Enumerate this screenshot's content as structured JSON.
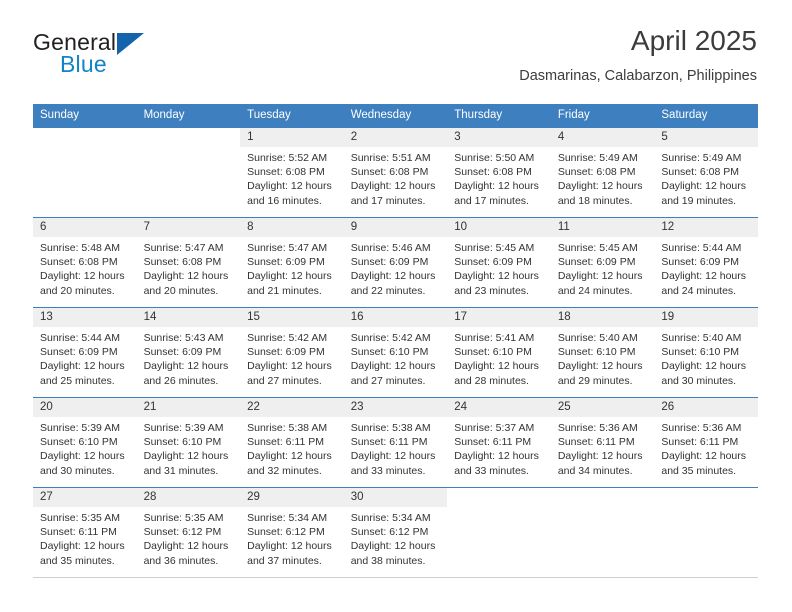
{
  "logo": {
    "word1": "General",
    "word2": "Blue",
    "triangle_color": "#1464ab",
    "blue_color": "#1383c6"
  },
  "header": {
    "title": "April 2025",
    "subtitle": "Dasmarinas, Calabarzon, Philippines"
  },
  "theme": {
    "header_blue": "#3d7fbf",
    "daynum_gray": "#efefef",
    "text": "#333333"
  },
  "calendar": {
    "weekday_headers": [
      "Sunday",
      "Monday",
      "Tuesday",
      "Wednesday",
      "Thursday",
      "Friday",
      "Saturday"
    ],
    "labels": {
      "sunrise": "Sunrise:",
      "sunset": "Sunset:",
      "daylight": "Daylight:"
    },
    "weeks": [
      [
        {
          "day": "",
          "sunrise": "",
          "sunset": "",
          "daylight_l1": "",
          "daylight_l2": ""
        },
        {
          "day": "",
          "sunrise": "",
          "sunset": "",
          "daylight_l1": "",
          "daylight_l2": ""
        },
        {
          "day": "1",
          "sunrise": "Sunrise: 5:52 AM",
          "sunset": "Sunset: 6:08 PM",
          "daylight_l1": "Daylight: 12 hours",
          "daylight_l2": "and 16 minutes."
        },
        {
          "day": "2",
          "sunrise": "Sunrise: 5:51 AM",
          "sunset": "Sunset: 6:08 PM",
          "daylight_l1": "Daylight: 12 hours",
          "daylight_l2": "and 17 minutes."
        },
        {
          "day": "3",
          "sunrise": "Sunrise: 5:50 AM",
          "sunset": "Sunset: 6:08 PM",
          "daylight_l1": "Daylight: 12 hours",
          "daylight_l2": "and 17 minutes."
        },
        {
          "day": "4",
          "sunrise": "Sunrise: 5:49 AM",
          "sunset": "Sunset: 6:08 PM",
          "daylight_l1": "Daylight: 12 hours",
          "daylight_l2": "and 18 minutes."
        },
        {
          "day": "5",
          "sunrise": "Sunrise: 5:49 AM",
          "sunset": "Sunset: 6:08 PM",
          "daylight_l1": "Daylight: 12 hours",
          "daylight_l2": "and 19 minutes."
        }
      ],
      [
        {
          "day": "6",
          "sunrise": "Sunrise: 5:48 AM",
          "sunset": "Sunset: 6:08 PM",
          "daylight_l1": "Daylight: 12 hours",
          "daylight_l2": "and 20 minutes."
        },
        {
          "day": "7",
          "sunrise": "Sunrise: 5:47 AM",
          "sunset": "Sunset: 6:08 PM",
          "daylight_l1": "Daylight: 12 hours",
          "daylight_l2": "and 20 minutes."
        },
        {
          "day": "8",
          "sunrise": "Sunrise: 5:47 AM",
          "sunset": "Sunset: 6:09 PM",
          "daylight_l1": "Daylight: 12 hours",
          "daylight_l2": "and 21 minutes."
        },
        {
          "day": "9",
          "sunrise": "Sunrise: 5:46 AM",
          "sunset": "Sunset: 6:09 PM",
          "daylight_l1": "Daylight: 12 hours",
          "daylight_l2": "and 22 minutes."
        },
        {
          "day": "10",
          "sunrise": "Sunrise: 5:45 AM",
          "sunset": "Sunset: 6:09 PM",
          "daylight_l1": "Daylight: 12 hours",
          "daylight_l2": "and 23 minutes."
        },
        {
          "day": "11",
          "sunrise": "Sunrise: 5:45 AM",
          "sunset": "Sunset: 6:09 PM",
          "daylight_l1": "Daylight: 12 hours",
          "daylight_l2": "and 24 minutes."
        },
        {
          "day": "12",
          "sunrise": "Sunrise: 5:44 AM",
          "sunset": "Sunset: 6:09 PM",
          "daylight_l1": "Daylight: 12 hours",
          "daylight_l2": "and 24 minutes."
        }
      ],
      [
        {
          "day": "13",
          "sunrise": "Sunrise: 5:44 AM",
          "sunset": "Sunset: 6:09 PM",
          "daylight_l1": "Daylight: 12 hours",
          "daylight_l2": "and 25 minutes."
        },
        {
          "day": "14",
          "sunrise": "Sunrise: 5:43 AM",
          "sunset": "Sunset: 6:09 PM",
          "daylight_l1": "Daylight: 12 hours",
          "daylight_l2": "and 26 minutes."
        },
        {
          "day": "15",
          "sunrise": "Sunrise: 5:42 AM",
          "sunset": "Sunset: 6:09 PM",
          "daylight_l1": "Daylight: 12 hours",
          "daylight_l2": "and 27 minutes."
        },
        {
          "day": "16",
          "sunrise": "Sunrise: 5:42 AM",
          "sunset": "Sunset: 6:10 PM",
          "daylight_l1": "Daylight: 12 hours",
          "daylight_l2": "and 27 minutes."
        },
        {
          "day": "17",
          "sunrise": "Sunrise: 5:41 AM",
          "sunset": "Sunset: 6:10 PM",
          "daylight_l1": "Daylight: 12 hours",
          "daylight_l2": "and 28 minutes."
        },
        {
          "day": "18",
          "sunrise": "Sunrise: 5:40 AM",
          "sunset": "Sunset: 6:10 PM",
          "daylight_l1": "Daylight: 12 hours",
          "daylight_l2": "and 29 minutes."
        },
        {
          "day": "19",
          "sunrise": "Sunrise: 5:40 AM",
          "sunset": "Sunset: 6:10 PM",
          "daylight_l1": "Daylight: 12 hours",
          "daylight_l2": "and 30 minutes."
        }
      ],
      [
        {
          "day": "20",
          "sunrise": "Sunrise: 5:39 AM",
          "sunset": "Sunset: 6:10 PM",
          "daylight_l1": "Daylight: 12 hours",
          "daylight_l2": "and 30 minutes."
        },
        {
          "day": "21",
          "sunrise": "Sunrise: 5:39 AM",
          "sunset": "Sunset: 6:10 PM",
          "daylight_l1": "Daylight: 12 hours",
          "daylight_l2": "and 31 minutes."
        },
        {
          "day": "22",
          "sunrise": "Sunrise: 5:38 AM",
          "sunset": "Sunset: 6:11 PM",
          "daylight_l1": "Daylight: 12 hours",
          "daylight_l2": "and 32 minutes."
        },
        {
          "day": "23",
          "sunrise": "Sunrise: 5:38 AM",
          "sunset": "Sunset: 6:11 PM",
          "daylight_l1": "Daylight: 12 hours",
          "daylight_l2": "and 33 minutes."
        },
        {
          "day": "24",
          "sunrise": "Sunrise: 5:37 AM",
          "sunset": "Sunset: 6:11 PM",
          "daylight_l1": "Daylight: 12 hours",
          "daylight_l2": "and 33 minutes."
        },
        {
          "day": "25",
          "sunrise": "Sunrise: 5:36 AM",
          "sunset": "Sunset: 6:11 PM",
          "daylight_l1": "Daylight: 12 hours",
          "daylight_l2": "and 34 minutes."
        },
        {
          "day": "26",
          "sunrise": "Sunrise: 5:36 AM",
          "sunset": "Sunset: 6:11 PM",
          "daylight_l1": "Daylight: 12 hours",
          "daylight_l2": "and 35 minutes."
        }
      ],
      [
        {
          "day": "27",
          "sunrise": "Sunrise: 5:35 AM",
          "sunset": "Sunset: 6:11 PM",
          "daylight_l1": "Daylight: 12 hours",
          "daylight_l2": "and 35 minutes."
        },
        {
          "day": "28",
          "sunrise": "Sunrise: 5:35 AM",
          "sunset": "Sunset: 6:12 PM",
          "daylight_l1": "Daylight: 12 hours",
          "daylight_l2": "and 36 minutes."
        },
        {
          "day": "29",
          "sunrise": "Sunrise: 5:34 AM",
          "sunset": "Sunset: 6:12 PM",
          "daylight_l1": "Daylight: 12 hours",
          "daylight_l2": "and 37 minutes."
        },
        {
          "day": "30",
          "sunrise": "Sunrise: 5:34 AM",
          "sunset": "Sunset: 6:12 PM",
          "daylight_l1": "Daylight: 12 hours",
          "daylight_l2": "and 38 minutes."
        },
        {
          "day": "",
          "sunrise": "",
          "sunset": "",
          "daylight_l1": "",
          "daylight_l2": ""
        },
        {
          "day": "",
          "sunrise": "",
          "sunset": "",
          "daylight_l1": "",
          "daylight_l2": ""
        },
        {
          "day": "",
          "sunrise": "",
          "sunset": "",
          "daylight_l1": "",
          "daylight_l2": ""
        }
      ]
    ]
  }
}
